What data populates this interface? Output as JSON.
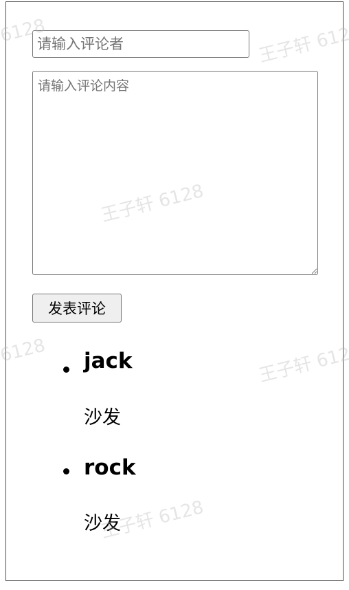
{
  "form": {
    "author_placeholder": "请输入评论者",
    "content_placeholder": "请输入评论内容",
    "submit_label": "发表评论"
  },
  "comments": [
    {
      "author": "jack",
      "content": "沙发"
    },
    {
      "author": "rock",
      "content": "沙发"
    }
  ],
  "watermark": {
    "text": "王子轩 6128",
    "fragment_left": "6128",
    "fragment_right": "王子轩 612"
  }
}
